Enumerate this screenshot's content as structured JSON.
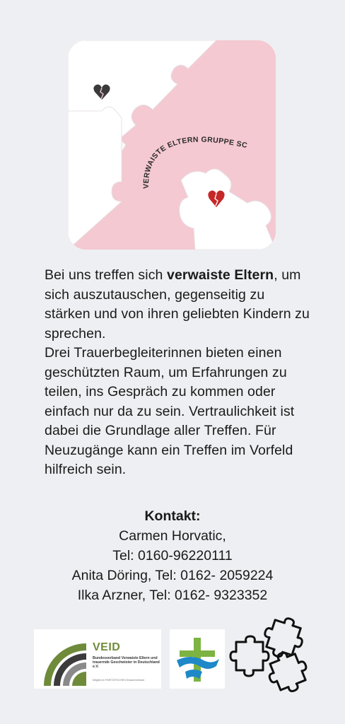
{
  "hero": {
    "arc_text": "VERWAISTE ELTERN GRUPPE SCHOPFHEIM",
    "icons": [
      "broken-heart-icon",
      "puzzle-piece-icon"
    ],
    "colors": {
      "background": "#f4c9d2",
      "heart_dark": "#3a3a3a",
      "heart_red": "#c62828"
    }
  },
  "intro": {
    "p1_before": "Bei uns treffen sich ",
    "p1_bold": "verwaiste Eltern",
    "p1_after": ", um sich auszutauschen, gegenseitig zu stärken und von ihren geliebten Kindern zu sprechen.",
    "p2": "Drei Trauerbegleiterinnen bieten einen geschützten Raum, um Erfahrungen zu teilen, ins Gespräch zu kommen oder einfach nur da zu sein. Vertraulichkeit ist dabei die Grundlage aller Treffen. Für Neuzugänge kann ein Treffen im Vorfeld hilfreich sein."
  },
  "contact": {
    "heading": "Kontakt:",
    "lines": [
      "Carmen Horvatic,",
      "Tel: 0160-96220111",
      "Anita Döring, Tel: 0162- 2059224",
      "Ilka Arzner, Tel:  0162- 9323352"
    ]
  },
  "logos": {
    "veid": {
      "title": "VEID",
      "subtitle": "Bundesverband Verwaiste Eltern und trauernde Geschwister in Deutschland e.V.",
      "member_note": "Mitglied im PARITÄTISCHEN Gesamtverband",
      "colors": {
        "green": "#6f8b3a",
        "dark": "#3b3b3b"
      }
    },
    "cross": {
      "icon": "church-cross-icon",
      "colors": {
        "green": "#7cb342",
        "blue": "#1e88c8"
      }
    },
    "puzzle": {
      "icon": "puzzle-pieces-icon"
    }
  }
}
